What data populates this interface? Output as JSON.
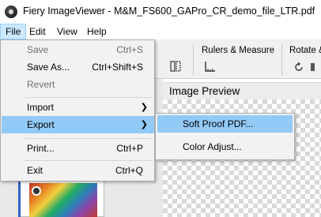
{
  "window": {
    "title": "Fiery ImageViewer - M&M_FS600_GAPro_CR_demo_file_LTR.pdf",
    "app_icon": "fiery-app-icon"
  },
  "menubar": [
    {
      "label": "File",
      "active": true
    },
    {
      "label": "Edit"
    },
    {
      "label": "View"
    },
    {
      "label": "Help"
    }
  ],
  "toolbar": {
    "groups": [
      {
        "label": "Rulers & Measure"
      },
      {
        "label": "Rotate &"
      }
    ],
    "icons": [
      "split-view-icon",
      "ruler-icon",
      "rotate-icon",
      "flip-icon"
    ]
  },
  "preview": {
    "header": "Image Preview"
  },
  "file_menu": {
    "items": [
      {
        "label": "Save",
        "shortcut": "Ctrl+S",
        "disabled": true
      },
      {
        "label": "Save As...",
        "shortcut": "Ctrl+Shift+S",
        "disabled": false
      },
      {
        "label": "Revert",
        "shortcut": "",
        "disabled": true
      },
      {
        "label": "Import",
        "submenu": true
      },
      {
        "label": "Export",
        "submenu": true,
        "highlighted": true
      },
      {
        "label": "Print...",
        "shortcut": "Ctrl+P"
      },
      {
        "label": "Exit",
        "shortcut": "Ctrl+Q"
      }
    ]
  },
  "export_submenu": {
    "items": [
      {
        "label": "Soft Proof PDF...",
        "highlighted": true
      },
      {
        "label": "Color Adjust..."
      }
    ]
  },
  "colors": {
    "menu_highlight": "#91c9f7",
    "menubar_active": "#cce8ff",
    "menu_bg": "#f2f2f2"
  }
}
